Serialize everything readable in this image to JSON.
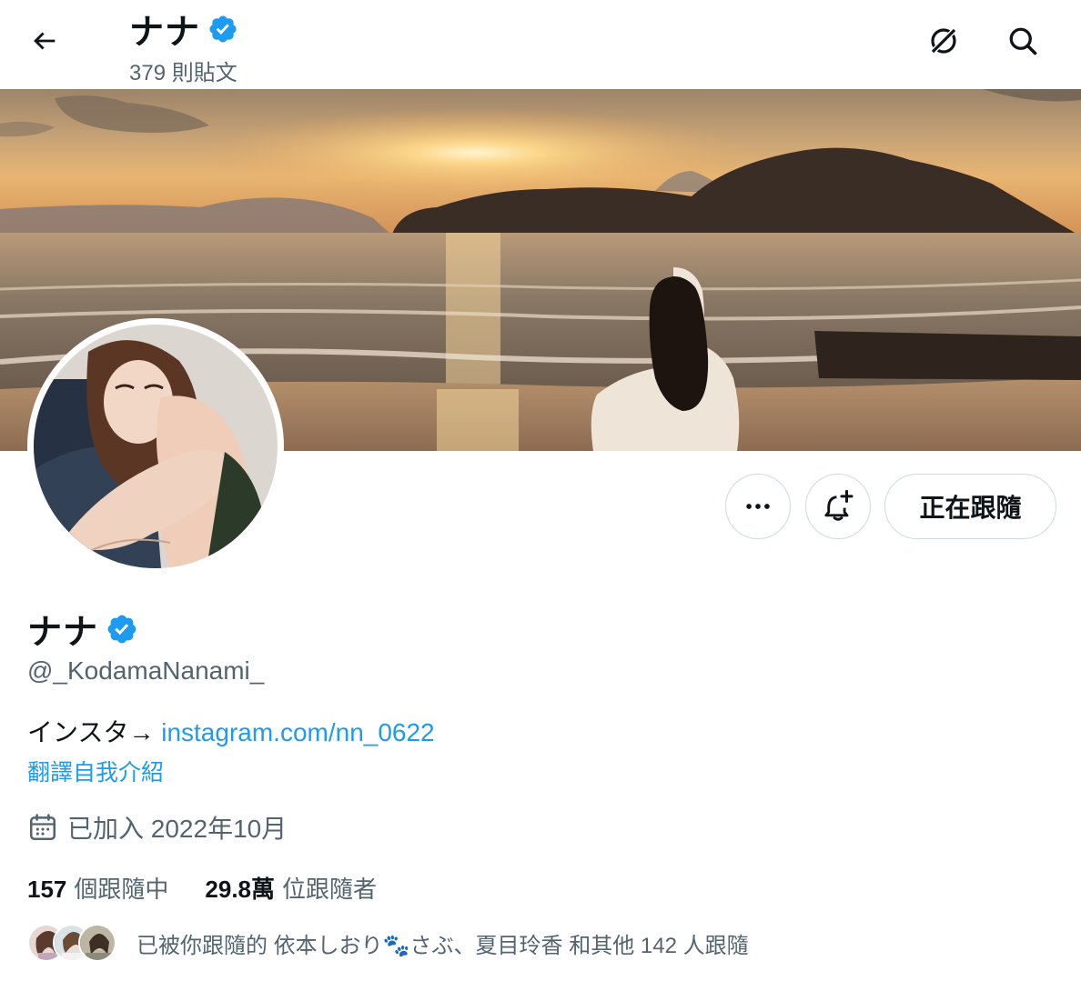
{
  "header": {
    "name": "ナナ",
    "post_count": "379 則貼文"
  },
  "profile": {
    "name": "ナナ",
    "handle": "@_KodamaNanami_",
    "bio_prefix": "インスタ→ ",
    "bio_link": "instagram.com/nn_0622",
    "translate_label": "翻譯自我介紹",
    "joined": "已加入 2022年10月",
    "following_count": "157",
    "following_label": "個跟隨中",
    "followers_count": "29.8萬",
    "followers_label": "位跟隨者",
    "followed_by": "已被你跟隨的 依本しおり🐾さぶ、夏目玲香 和其他 142 人跟隨"
  },
  "actions": {
    "follow_label": "正在跟隨"
  },
  "icons": {
    "back": "arrow-left-icon",
    "grok": "grok-icon",
    "search": "search-icon",
    "more": "more-dots-icon",
    "notify": "bell-plus-icon",
    "verified": "verified-badge-icon",
    "calendar": "calendar-icon"
  },
  "colors": {
    "accent": "#1d9bf0",
    "text": "#0f1419",
    "muted": "#536471",
    "border": "#cfd9de"
  }
}
